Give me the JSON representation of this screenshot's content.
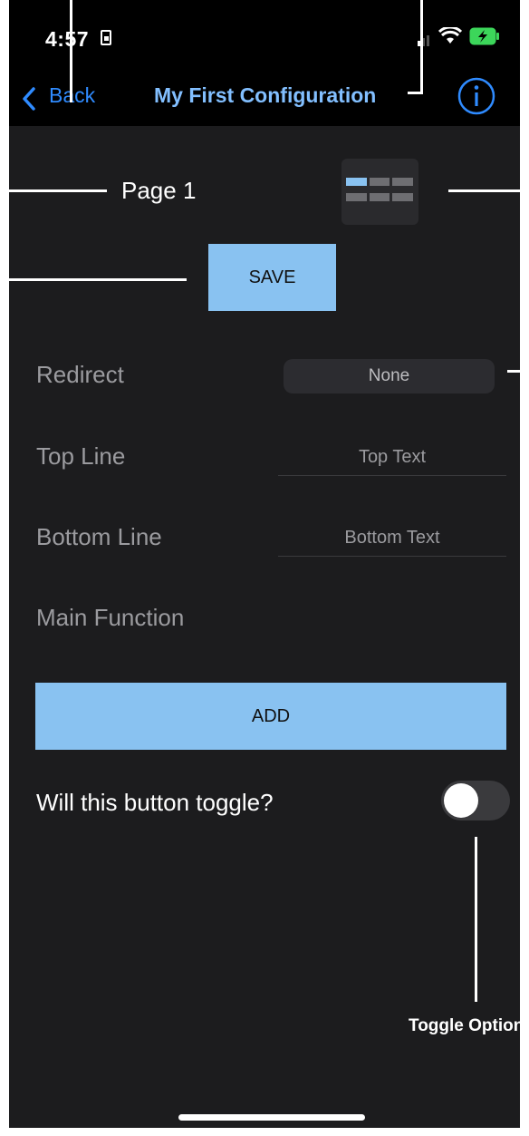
{
  "status_bar": {
    "time": "4:57"
  },
  "nav": {
    "back_label": "Back",
    "title": "My First Configuration"
  },
  "page": {
    "label": "Page 1",
    "save_label": "SAVE"
  },
  "form": {
    "redirect": {
      "label": "Redirect",
      "value": "None"
    },
    "top_line": {
      "label": "Top Line",
      "placeholder": "Top Text"
    },
    "bottom_line": {
      "label": "Bottom Line",
      "placeholder": "Bottom Text"
    },
    "main_function": {
      "label": "Main Function"
    },
    "add_label": "ADD",
    "toggle": {
      "label": "Will this button toggle?",
      "on": false
    }
  },
  "annotations": {
    "toggle_callout": "Toggle Option"
  },
  "colors": {
    "accent": "#89c2f1",
    "link": "#2f8bff",
    "title": "#82bfff",
    "background": "#1c1c1e"
  }
}
